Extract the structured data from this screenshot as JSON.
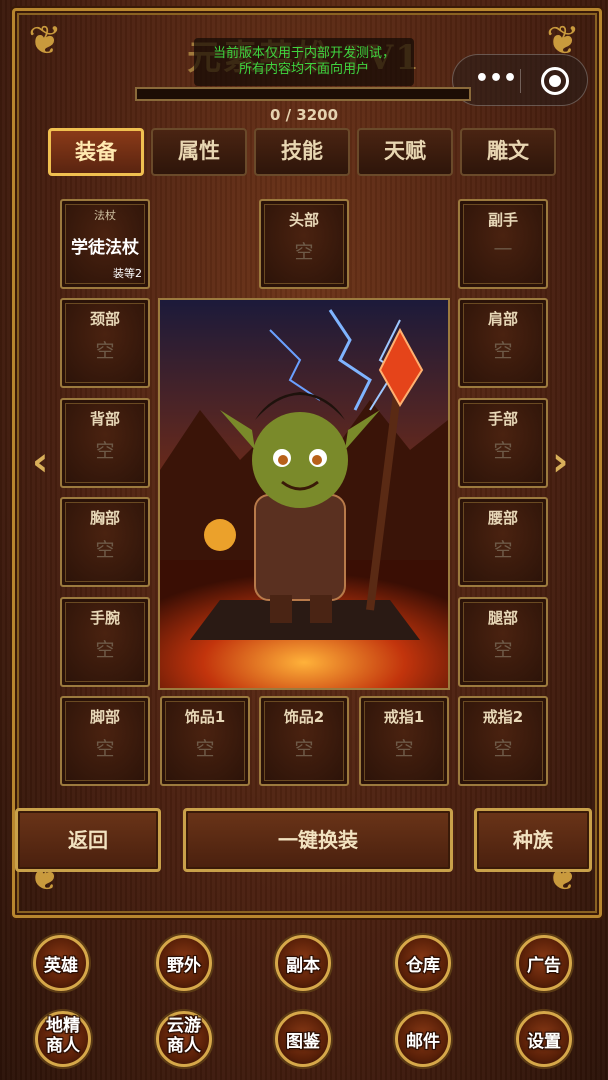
{
  "title": "元素英雄 LV1",
  "notice_lines": [
    "当前版本仅用于内部开发测试，",
    "所有内容均不面向用户"
  ],
  "xp": {
    "text": "0 / 3200",
    "fill": 0
  },
  "tabs": [
    "装备",
    "属性",
    "技能",
    "天赋",
    "雕文"
  ],
  "active_tab": 0,
  "slots": {
    "weapon": {
      "type": "法杖",
      "name": "学徒法杖",
      "req": "装等2"
    },
    "head": {
      "label": "头部",
      "value": "空"
    },
    "offhand": {
      "label": "副手",
      "value": "—"
    },
    "neck": {
      "label": "颈部",
      "value": "空"
    },
    "shoulder": {
      "label": "肩部",
      "value": "空"
    },
    "back": {
      "label": "背部",
      "value": "空"
    },
    "hands": {
      "label": "手部",
      "value": "空"
    },
    "chest": {
      "label": "胸部",
      "value": "空"
    },
    "waist": {
      "label": "腰部",
      "value": "空"
    },
    "wrist": {
      "label": "手腕",
      "value": "空"
    },
    "legs": {
      "label": "腿部",
      "value": "空"
    },
    "feet": {
      "label": "脚部",
      "value": "空"
    },
    "trinket1": {
      "label": "饰品1",
      "value": "空"
    },
    "trinket2": {
      "label": "饰品2",
      "value": "空"
    },
    "ring1": {
      "label": "戒指1",
      "value": "空"
    },
    "ring2": {
      "label": "戒指2",
      "value": "空"
    }
  },
  "buttons": {
    "back": "返回",
    "auto_equip": "一键换装",
    "race": "种族"
  },
  "arrows": {
    "left": "‹",
    "right": "›"
  },
  "capsule": {
    "more": "•••"
  },
  "nav_row1": [
    "英雄",
    "野外",
    "副本",
    "仓库",
    "广告"
  ],
  "nav_row2": [
    [
      "地精",
      "商人"
    ],
    [
      "云游",
      "商人"
    ],
    [
      "图鉴"
    ],
    [
      "邮件"
    ],
    [
      "设置"
    ]
  ],
  "colors": {
    "accent_gold": "#c9a14a",
    "notice_green": "#3fd43f",
    "wood_dark": "#2a1309"
  }
}
